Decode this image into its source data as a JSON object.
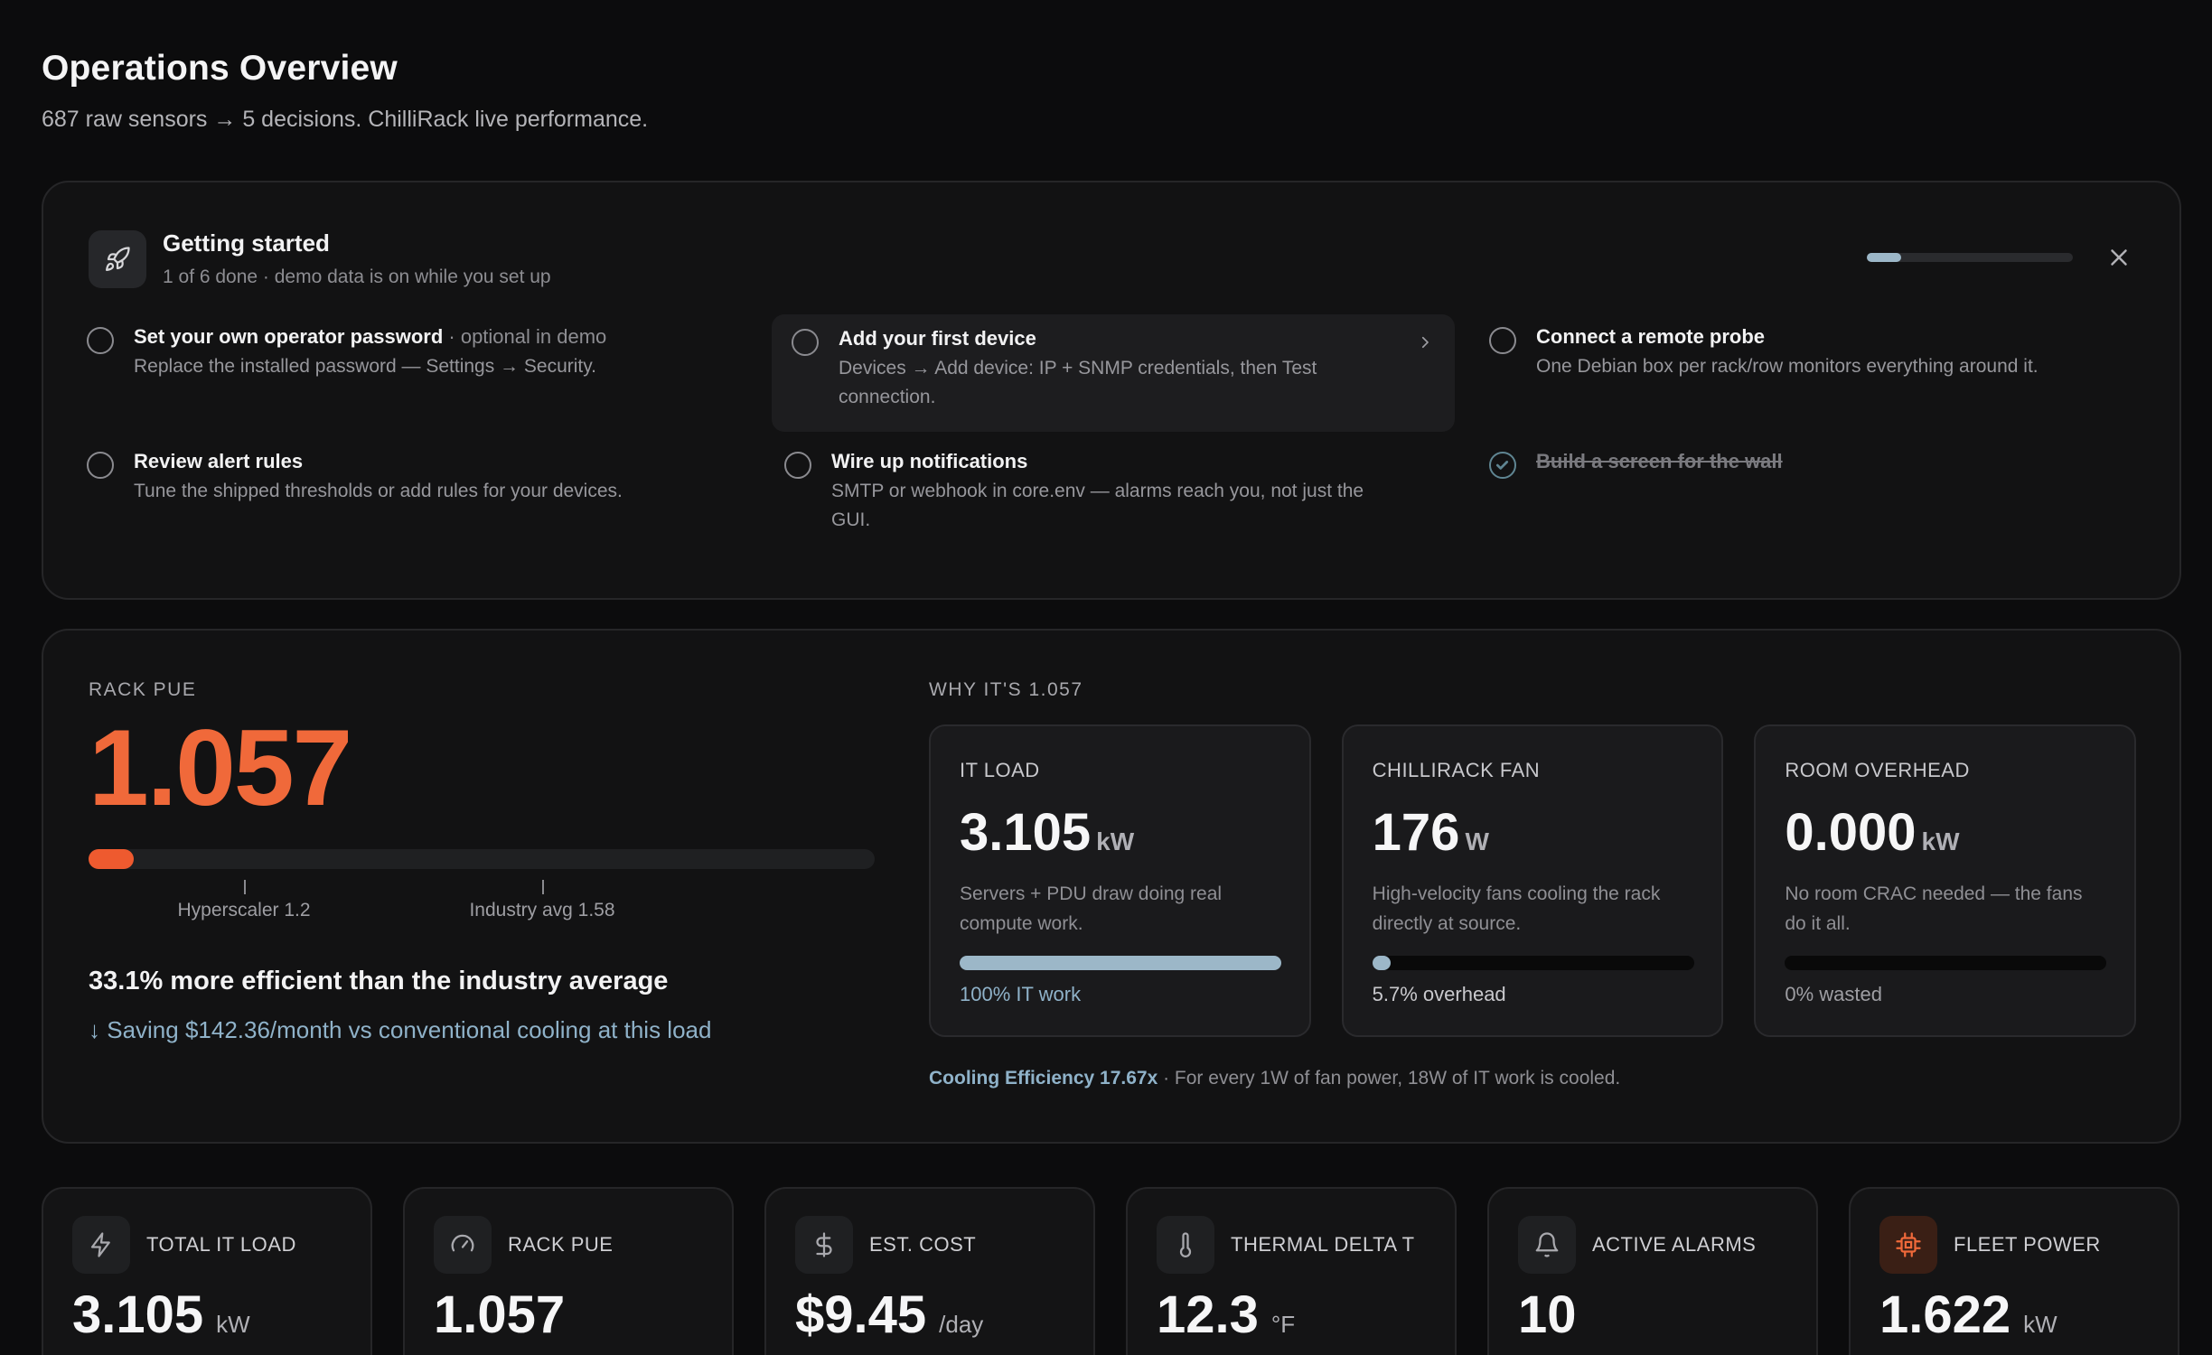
{
  "page": {
    "title": "Operations Overview",
    "subtitle": "687 raw sensors → 5 decisions. ChilliRack live performance."
  },
  "getting_started": {
    "title": "Getting started",
    "subtitle": "1 of 6 done · demo data is on while you set up",
    "progress_fraction": 0.167,
    "tasks": [
      {
        "title": "Set your own operator password",
        "note": " · optional in demo",
        "desc": "Replace the installed password — Settings → Security.",
        "done": false
      },
      {
        "title": "Add your first device",
        "note": "",
        "desc": "Devices → Add device: IP + SNMP credentials, then Test connection.",
        "done": false
      },
      {
        "title": "Connect a remote probe",
        "note": "",
        "desc": "One Debian box per rack/row monitors everything around it.",
        "done": false
      },
      {
        "title": "Review alert rules",
        "note": "",
        "desc": "Tune the shipped thresholds or add rules for your devices.",
        "done": false
      },
      {
        "title": "Wire up notifications",
        "note": "",
        "desc": "SMTP or webhook in core.env — alarms reach you, not just the GUI.",
        "done": false
      },
      {
        "title": "Build a screen for the wall",
        "note": "",
        "desc": "",
        "done": true
      }
    ]
  },
  "pue": {
    "label": "RACK PUE",
    "value": "1.057",
    "benchmarks": [
      {
        "label": "Hyperscaler 1.2",
        "value": 1.2
      },
      {
        "label": "Industry avg 1.58",
        "value": 1.58
      }
    ],
    "efficiency_text": "33.1% more efficient than the industry average",
    "saving_text": "↓ Saving $142.36/month vs conventional cooling at this load"
  },
  "why": {
    "label": "WHY IT'S 1.057",
    "cards": [
      {
        "header": "IT LOAD",
        "value": "3.105",
        "unit": "kW",
        "desc": "Servers + PDU draw doing real compute work.",
        "fraction": 1.0,
        "caption": "100% IT work",
        "caption_color": "#8fb2c9"
      },
      {
        "header": "CHILLIRACK FAN",
        "value": "176",
        "unit": "W",
        "desc": "High-velocity fans cooling the rack directly at source.",
        "fraction": 0.057,
        "caption": "5.7% overhead",
        "caption_color": "#c9c9cd"
      },
      {
        "header": "ROOM OVERHEAD",
        "value": "0.000",
        "unit": "kW",
        "desc": "No room CRAC needed — the fans do it all.",
        "fraction": 0.0,
        "caption": "0% wasted",
        "caption_color": "#9e9ea3"
      }
    ],
    "cooling_efficiency": "Cooling Efficiency 17.67x",
    "cooling_note": " · For every 1W of fan power, 18W of IT work is cooled."
  },
  "tiles": [
    {
      "label": "TOTAL IT LOAD",
      "value": "3.105",
      "unit": "kW",
      "icon": "bolt-icon"
    },
    {
      "label": "RACK PUE",
      "value": "1.057",
      "unit": "",
      "icon": "gauge-icon"
    },
    {
      "label": "EST. COST",
      "value": "$9.45",
      "unit": "/day",
      "icon": "dollar-icon"
    },
    {
      "label": "THERMAL DELTA T",
      "value": "12.3",
      "unit": "°F",
      "icon": "thermometer-icon"
    },
    {
      "label": "ACTIVE ALARMS",
      "value": "10",
      "unit": "",
      "icon": "bell-icon"
    },
    {
      "label": "FLEET POWER",
      "value": "1.622",
      "unit": "kW",
      "icon": "chip-icon",
      "accent": "#f0693a"
    }
  ]
}
